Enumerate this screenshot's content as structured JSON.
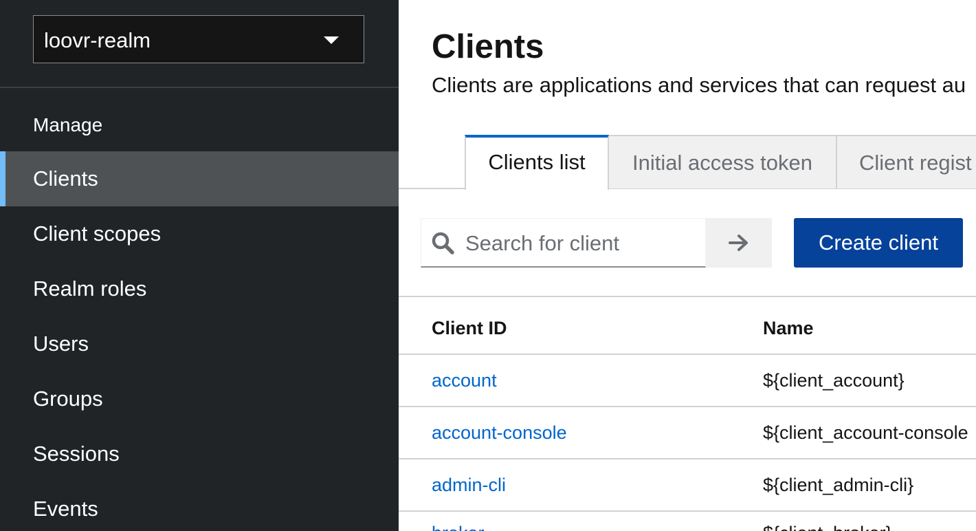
{
  "sidebar": {
    "realm": "loovr-realm",
    "section": "Manage",
    "items": [
      {
        "label": "Clients",
        "active": true
      },
      {
        "label": "Client scopes"
      },
      {
        "label": "Realm roles"
      },
      {
        "label": "Users"
      },
      {
        "label": "Groups"
      },
      {
        "label": "Sessions"
      },
      {
        "label": "Events"
      }
    ]
  },
  "main": {
    "title": "Clients",
    "description": "Clients are applications and services that can request au",
    "tabs": [
      {
        "label": "Clients list",
        "active": true
      },
      {
        "label": "Initial access token"
      },
      {
        "label": "Client regist"
      }
    ],
    "search": {
      "placeholder": "Search for client",
      "value": ""
    },
    "create_button": "Create client",
    "table": {
      "headers": [
        "Client ID",
        "Name"
      ],
      "rows": [
        {
          "client_id": "account",
          "name": "${client_account}"
        },
        {
          "client_id": "account-console",
          "name": "${client_account-console"
        },
        {
          "client_id": "admin-cli",
          "name": "${client_admin-cli}"
        },
        {
          "client_id": "broker",
          "name": "${client_broker}"
        }
      ]
    }
  },
  "colors": {
    "sidebar_bg": "#212427",
    "active_item_bg": "#4f5255",
    "active_indicator": "#73bcf7",
    "primary_button": "#06429a",
    "link": "#0066cc",
    "active_tab_border": "#0066cc"
  },
  "icons": {
    "realm_caret": "caret-down-icon",
    "search": "search-icon",
    "submit": "arrow-right-icon"
  }
}
